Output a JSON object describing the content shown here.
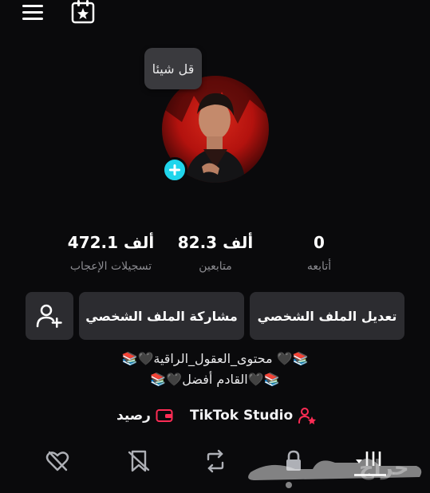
{
  "bubble": {
    "text": "قل شيئا"
  },
  "stats": [
    {
      "value": "472.1 ألف",
      "label": "تسجيلات الإعجاب"
    },
    {
      "value": "82.3 ألف",
      "label": "متابعين"
    },
    {
      "value": "0",
      "label": "أتابعه"
    }
  ],
  "buttons": {
    "edit_profile": "تعديل الملف الشخصي",
    "share_profile": "مشاركة الملف الشخصي"
  },
  "bio": {
    "line1": "📚🖤 محتوى_العقول_الراقية🖤📚",
    "line2": "📚🖤القادم أفضل🖤📚"
  },
  "links": {
    "studio": "TikTok Studio",
    "balance": "رصيد"
  },
  "watermark": {
    "text": "حراج"
  },
  "colors": {
    "accent_cyan": "#20d5ec",
    "accent_pink": "#fe2c55",
    "button_bg": "#2c2c30"
  },
  "icons": [
    "menu-icon",
    "calendar-star-icon",
    "plus-icon",
    "add-friend-icon",
    "studio-person-icon",
    "wallet-icon",
    "liked-hidden-icon",
    "favorites-hidden-icon",
    "repost-icon",
    "lock-icon",
    "grid-icon"
  ]
}
